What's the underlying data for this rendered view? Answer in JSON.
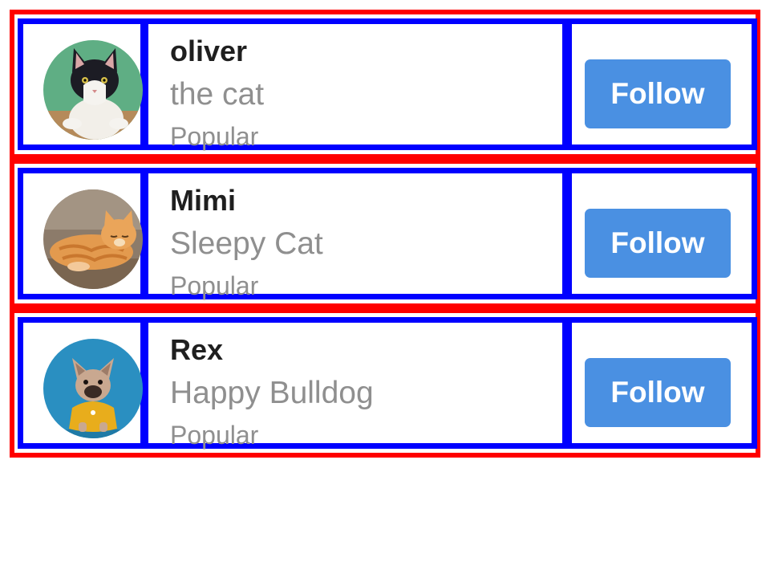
{
  "colors": {
    "row_border": "#ff0000",
    "cell_border": "#0000ff",
    "button_bg": "#4a90e2",
    "button_text": "#ffffff",
    "name_text": "#1f1f1f",
    "muted_text": "#8f8f8f"
  },
  "profiles": [
    {
      "name": "oliver",
      "subtitle": "the cat",
      "tag": "Popular",
      "avatar": "black-white-cat-photo",
      "button_label": "Follow"
    },
    {
      "name": "Mimi",
      "subtitle": "Sleepy Cat",
      "tag": "Popular",
      "avatar": "orange-tabby-cat-photo",
      "button_label": "Follow"
    },
    {
      "name": "Rex",
      "subtitle": "Happy Bulldog",
      "tag": "Popular",
      "avatar": "french-bulldog-photo",
      "button_label": "Follow"
    }
  ]
}
